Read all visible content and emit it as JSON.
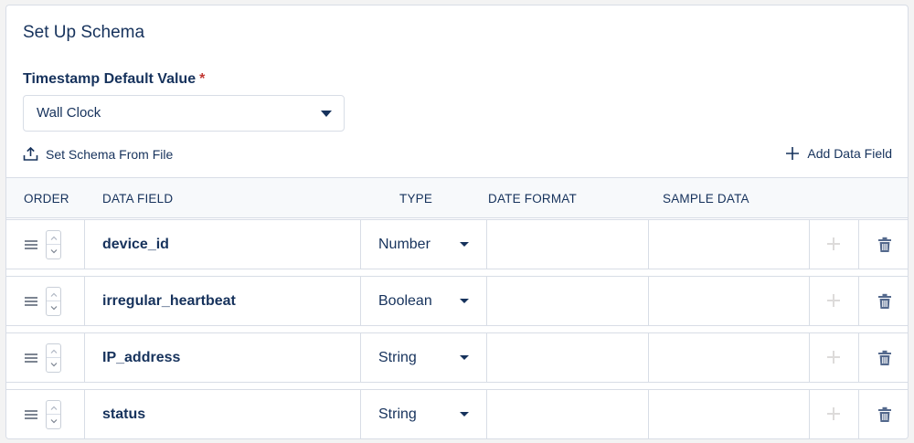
{
  "card": {
    "title": "Set Up Schema"
  },
  "timestamp": {
    "label": "Timestamp Default Value",
    "required_mark": "*",
    "selected": "Wall Clock"
  },
  "actions": {
    "set_schema_label": "Set Schema From File",
    "add_field_label": "Add Data Field"
  },
  "table": {
    "headers": {
      "order": "ORDER",
      "data_field": "DATA FIELD",
      "type": "TYPE",
      "date_format": "DATE FORMAT",
      "sample_data": "SAMPLE DATA"
    },
    "rows": [
      {
        "field": "device_id",
        "type": "Number",
        "date_format": "",
        "sample_data": ""
      },
      {
        "field": "irregular_heartbeat",
        "type": "Boolean",
        "date_format": "",
        "sample_data": ""
      },
      {
        "field": "IP_address",
        "type": "String",
        "date_format": "",
        "sample_data": ""
      },
      {
        "field": "status",
        "type": "String",
        "date_format": "",
        "sample_data": ""
      }
    ]
  },
  "icons": {
    "upload": "upload-icon",
    "add": "plus-icon",
    "drag": "drag-handle-icon",
    "stepper_up": "chevron-up-icon",
    "stepper_down": "chevron-down-icon",
    "row_add": "plus-icon",
    "row_delete": "trash-icon",
    "dropdown": "caret-down-icon"
  },
  "colors": {
    "text": "#16325c",
    "border": "#d8dde6",
    "header_bg": "#f7f9fb",
    "required": "#c23934",
    "disabled_icon": "#dddbda",
    "trash_icon": "#54698d"
  }
}
